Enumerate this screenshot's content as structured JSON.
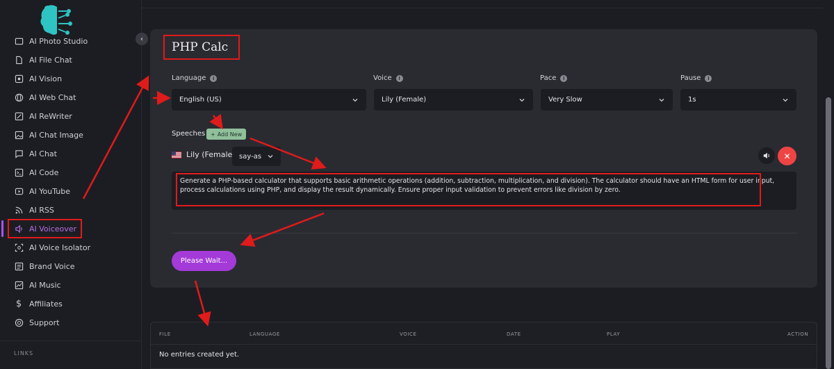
{
  "sidebar": {
    "items": [
      {
        "label": "AI Photo Studio",
        "icon": "photo-icon"
      },
      {
        "label": "AI File Chat",
        "icon": "file-icon"
      },
      {
        "label": "AI Vision",
        "icon": "eye-icon"
      },
      {
        "label": "AI Web Chat",
        "icon": "globe-icon"
      },
      {
        "label": "AI ReWriter",
        "icon": "pen-icon"
      },
      {
        "label": "AI Chat Image",
        "icon": "image-icon"
      },
      {
        "label": "AI Chat",
        "icon": "chat-icon"
      },
      {
        "label": "AI Code",
        "icon": "code-icon"
      },
      {
        "label": "AI YouTube",
        "icon": "youtube-icon"
      },
      {
        "label": "AI RSS",
        "icon": "rss-icon"
      },
      {
        "label": "AI Voiceover",
        "icon": "speaker-icon"
      },
      {
        "label": "AI Voice Isolator",
        "icon": "isolator-icon"
      },
      {
        "label": "Brand Voice",
        "icon": "brand-icon"
      },
      {
        "label": "AI Music",
        "icon": "music-icon"
      },
      {
        "label": "Affiliates",
        "icon": "dollar-icon"
      },
      {
        "label": "Support",
        "icon": "support-icon"
      }
    ],
    "active_index": 10,
    "links_label": "LINKS"
  },
  "page": {
    "title": "PHP Calc"
  },
  "form": {
    "language": {
      "label": "Language",
      "value": "English (US)"
    },
    "voice": {
      "label": "Voice",
      "value": "Lily (Female)"
    },
    "pace": {
      "label": "Pace",
      "value": "Very Slow"
    },
    "pause": {
      "label": "Pause",
      "value": "1s"
    },
    "speeches_label": "Speeches",
    "add_new_label": "Add New",
    "speaker_name": "Lily (Female)",
    "say_as": "say-as",
    "speech_text": "Generate a PHP-based calculator that supports basic arithmetic operations (addition, subtraction, multiplication, and division). The calculator should have an HTML form for user input, process calculations using PHP, and display the result dynamically. Ensure proper input validation to prevent errors like division by zero.",
    "submit_label": "Please Wait..."
  },
  "table": {
    "columns": [
      "FILE",
      "LANGUAGE",
      "VOICE",
      "DATE",
      "PLAY",
      "ACTION"
    ],
    "empty_text": "No entries created yet."
  },
  "colors": {
    "accent": "#a43ad8",
    "active_nav": "#b46ee6",
    "annotation": "#e01b1b",
    "danger": "#ef4444",
    "add_new": "#8fbf9b"
  }
}
